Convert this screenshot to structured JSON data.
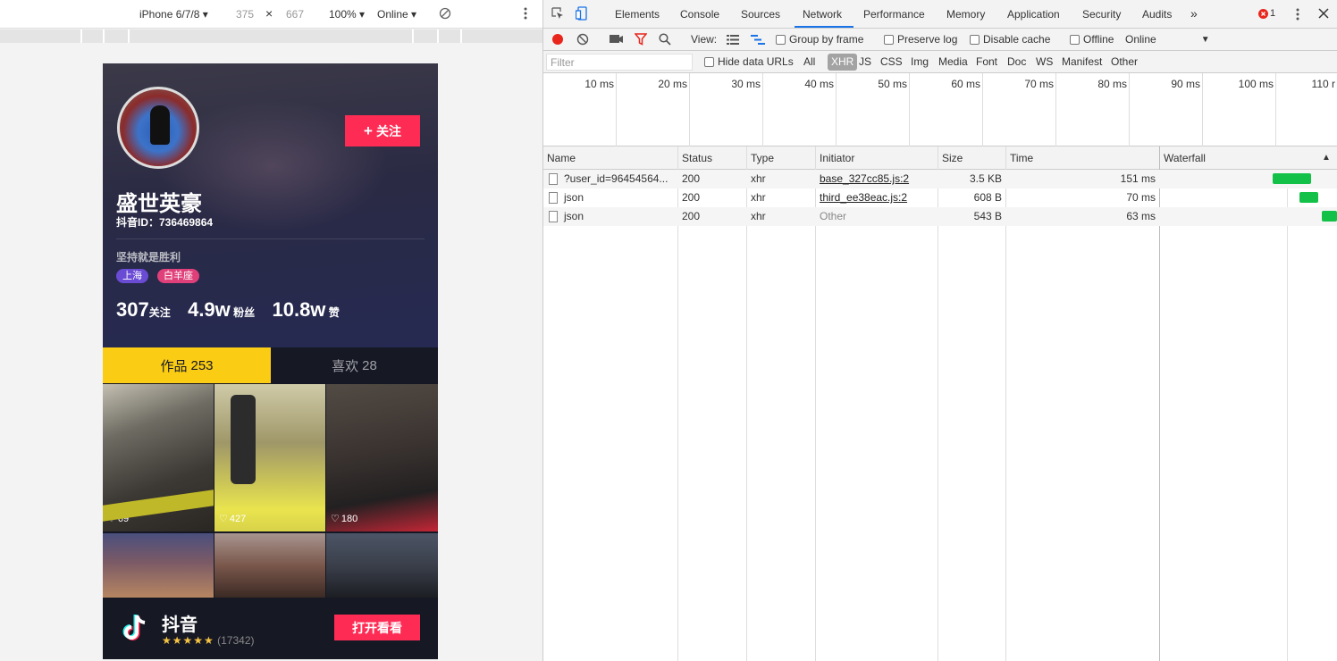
{
  "device_bar": {
    "device": "iPhone 6/7/8 ▾",
    "width": "375",
    "times": "×",
    "height": "667",
    "zoom": "100% ▾",
    "network": "Online ▾"
  },
  "profile": {
    "follow_label": "关注",
    "name": "盛世英豪",
    "douyin_id": "抖音ID：736469864",
    "signature": "坚持就是胜利",
    "tags": [
      "上海",
      "白羊座"
    ],
    "stats": [
      {
        "value": "307",
        "unit": "关注"
      },
      {
        "value": "4.9w",
        "unit": "粉丝"
      },
      {
        "value": "10.8w",
        "unit": "赞"
      }
    ],
    "tabs": [
      {
        "label": "作品",
        "count": "253"
      },
      {
        "label": "喜欢",
        "count": "28"
      }
    ],
    "videos": [
      {
        "likes": "69"
      },
      {
        "likes": "427"
      },
      {
        "likes": "180"
      }
    ],
    "banner": {
      "app_name": "抖音",
      "stars": "★★★★★",
      "rating_count": "(17342)",
      "open_label": "打开看看"
    }
  },
  "devtools": {
    "tabs": [
      "Elements",
      "Console",
      "Sources",
      "Network",
      "Performance",
      "Memory",
      "Application",
      "Security",
      "Audits"
    ],
    "more": "»",
    "error_count": "1",
    "toolbar": {
      "view_label": "View:",
      "group_by_frame": "Group by frame",
      "preserve_log": "Preserve log",
      "disable_cache": "Disable cache",
      "offline": "Offline",
      "throttle": "Online"
    },
    "filter_placeholder": "Filter",
    "hide_data_urls": "Hide data URLs",
    "types": [
      "All",
      "XHR",
      "JS",
      "CSS",
      "Img",
      "Media",
      "Font",
      "Doc",
      "WS",
      "Manifest",
      "Other"
    ],
    "ticks": [
      "10 ms",
      "20 ms",
      "30 ms",
      "40 ms",
      "50 ms",
      "60 ms",
      "70 ms",
      "80 ms",
      "90 ms",
      "100 ms",
      "110 r"
    ],
    "columns": [
      "Name",
      "Status",
      "Type",
      "Initiator",
      "Size",
      "Time",
      "Waterfall"
    ],
    "rows": [
      {
        "name": "?user_id=96454564...",
        "status": "200",
        "type": "xhr",
        "initiator": "base_327cc85.js:2",
        "size": "3.5 KB",
        "time": "151 ms"
      },
      {
        "name": "json",
        "status": "200",
        "type": "xhr",
        "initiator": "third_ee38eac.js:2",
        "size": "608 B",
        "time": "70 ms"
      },
      {
        "name": "json",
        "status": "200",
        "type": "xhr",
        "initiator": "Other",
        "size": "543 B",
        "time": "63 ms"
      }
    ],
    "colors": {
      "accent": "#1a73e8",
      "bar": "#13c148",
      "record": "#e8261c"
    }
  }
}
